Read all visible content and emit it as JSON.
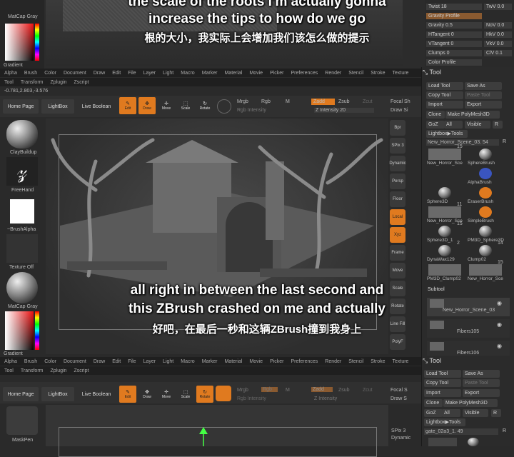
{
  "captions": {
    "top_en_1": "the scale of the roots I'm actually gonna",
    "top_en_2": "increase the tips to how do we go",
    "top_zh": "根的大小，我实际上会增加我们该怎么做的提示",
    "mid_en_1": "all right in between the last second and",
    "mid_en_2": "this ZBrush crashed on me and actually",
    "mid_zh": "好吧，在最后一秒和这辆ZBrush撞到我身上"
  },
  "left_top": {
    "matcap_label": "MatCap Gray",
    "gradient_label": "Gradient"
  },
  "menu": [
    "Alpha",
    "Brush",
    "Color",
    "Document",
    "Draw",
    "Edit",
    "File",
    "Layer",
    "Light",
    "Macro",
    "Marker",
    "Material",
    "Movie",
    "Picker",
    "Preferences",
    "Render",
    "Stencil",
    "Stroke",
    "Texture"
  ],
  "submenu": [
    "Tool",
    "Transform",
    "Zplugin",
    "Zscript"
  ],
  "coords": "-0.781,2.803,-3.576",
  "shelf": {
    "home": "Home Page",
    "lightbox": "LightBox",
    "live_boolean": "Live Boolean",
    "edit": "Edit",
    "draw": "Draw",
    "move": "Move",
    "scale": "Scale",
    "rotate": "Rotate",
    "mrgb": "Mrgb",
    "rgb": "Rgb",
    "m": "M",
    "rgb_intensity": "Rgb Intensity",
    "zadd": "Zadd",
    "zsub": "Zsub",
    "zcut": "Zcut",
    "z_intensity": "Z Intensity 20",
    "focal": "Focal Sh",
    "draw_size": "Draw Si"
  },
  "left_tools": {
    "brush1": "ClayBuildup",
    "brush2": "FreeHand",
    "alpha": "~BrushAlpha",
    "texture": "Texture Off",
    "material": "MatCap Gray",
    "gradient": "Gradient"
  },
  "right_icons": [
    "Bpr",
    "SPix 3",
    "Dynamic",
    "Persp",
    "Floor",
    "Local",
    "Xyz",
    "Frame",
    "Move",
    "Scale",
    "Rotate",
    "Line Fill",
    "PolyF"
  ],
  "top_right_sliders": [
    {
      "label": "Twist 18",
      "val": "TwV 0.0"
    },
    {
      "label": "Gravity Profile",
      "val": ""
    },
    {
      "label": "Gravity 0.5",
      "val": "NoV 0.0"
    },
    {
      "label": "HTangent 0",
      "val": "HkV 0.0"
    },
    {
      "label": "VTangent 0",
      "val": "VkV 0.0"
    },
    {
      "label": "Clumps 0",
      "val": "ClV 0.1"
    },
    {
      "label": "Color Profile",
      "val": ""
    }
  ],
  "tool_panel": {
    "title": "Tool",
    "load": "Load Tool",
    "save": "Save As",
    "copy": "Copy Tool",
    "paste": "Paste Tool",
    "import": "Import",
    "export": "Export",
    "clone": "Clone",
    "make": "Make PolyMesh3D",
    "goz": "GoZ",
    "all": "All",
    "visible": "Visible",
    "r": "R",
    "lightbox_tools": "Lightbox▶Tools",
    "current": "New_Horror_Scene_03. 54",
    "thumbs": [
      {
        "name": "New_Horror_Sce",
        "num": "15"
      },
      {
        "name": "SphereBrush",
        "num": ""
      },
      {
        "name": "AlphaBrush",
        "num": ""
      },
      {
        "name": "Sphere3D",
        "num": ""
      },
      {
        "name": "EraserBrush",
        "num": ""
      },
      {
        "name": "New_Horror_Sce",
        "num": "11"
      },
      {
        "name": "SimpleBrush",
        "num": ""
      },
      {
        "name": "Sphere3D_1",
        "num": "15"
      },
      {
        "name": "PM3D_Sphere3D",
        "num": ""
      },
      {
        "name": "DynaWax129",
        "num": "2"
      },
      {
        "name": "Clump02",
        "num": "14"
      },
      {
        "name": "PM3D_Clump02",
        "num": ""
      },
      {
        "name": "New_Horror_Sce",
        "num": "15"
      }
    ],
    "subtool_title": "Subtool",
    "subtools": [
      "New_Horror_Scene_03",
      "Fibers105",
      "Fibers106"
    ]
  },
  "bottom": {
    "menu": [
      "Alpha",
      "Brush",
      "Color",
      "Document",
      "Draw",
      "Edit",
      "File",
      "Layer",
      "Light",
      "Macro",
      "Marker",
      "Material",
      "Movie",
      "Picker",
      "Preferences",
      "Render",
      "Stencil",
      "Stroke",
      "Texture"
    ],
    "home": "Home Page",
    "lightbox": "LightBox",
    "live_boolean": "Live Boolean",
    "edit": "Edit",
    "draw": "Draw",
    "move": "Move",
    "scale": "Scale",
    "rotate": "Rotate",
    "mrgb": "Mrgb",
    "rgb": "Rgb",
    "m": "M",
    "rgb_intensity": "Rgb Intensity",
    "zadd": "Zadd",
    "zsub": "Zsub",
    "zcut": "Zcut",
    "z_intensity": "Z Intensity",
    "focal": "Focal S",
    "draw_size": "Draw S",
    "brush": "MaskPen",
    "spix": "SPix 3",
    "dynamic": "Dynamic",
    "tool_title": "Tool",
    "load": "Load Tool",
    "save": "Save As",
    "copy": "Copy Tool",
    "paste": "Paste Tool",
    "import": "Import",
    "export": "Export",
    "clone": "Clone",
    "make": "Make PolyMesh3D",
    "goz": "GoZ",
    "all": "All",
    "visible": "Visible",
    "r": "R",
    "lightbox_tools": "Lightbox▶Tools",
    "current": "gate_02a3_1. 49"
  },
  "accent": "#e07a1f"
}
